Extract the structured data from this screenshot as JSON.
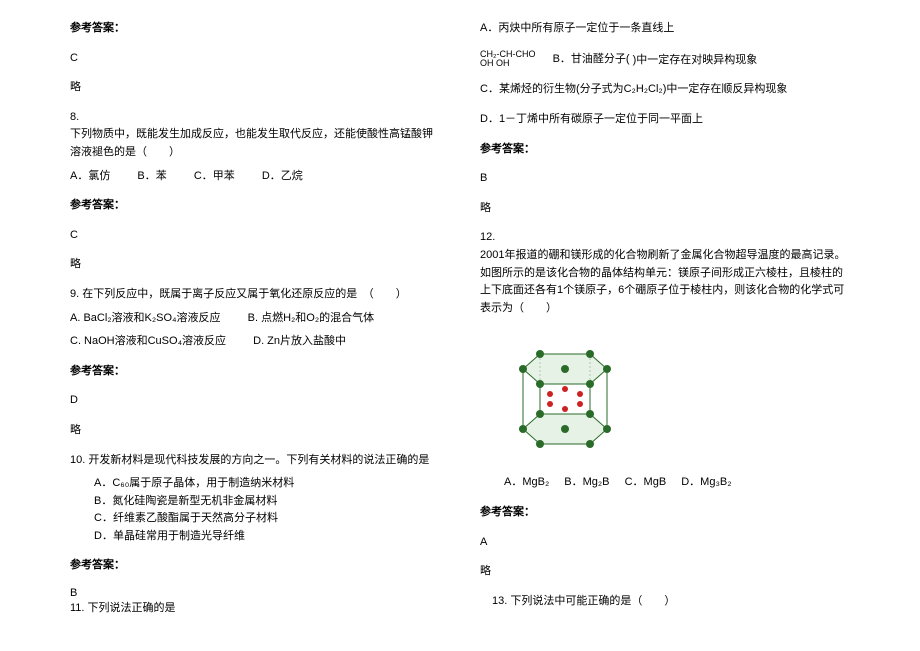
{
  "labels": {
    "answer_heading": "参考答案：",
    "lue": "略"
  },
  "left": {
    "ans7": "C",
    "q8": {
      "num": "8.",
      "stem": "下列物质中，既能发生加成反应，也能发生取代反应，还能使酸性高锰酸钾溶液褪色的是（　　）",
      "a": "A．氯仿",
      "b": "B．苯",
      "c": "C．甲苯",
      "d": "D．乙烷",
      "ans": "C"
    },
    "q9": {
      "stem": "9. 在下列反应中，既属于离子反应又属于氧化还原反应的是　（　　）",
      "a": "A. BaCl₂溶液和K₂SO₄溶液反应",
      "b": "B. 点燃H₂和O₂的混合气体",
      "c": "C. NaOH溶液和CuSO₄溶液反应",
      "d": "D. Zn片放入盐酸中",
      "ans": "D"
    },
    "q10": {
      "stem": "10. 开发新材料是现代科技发展的方向之一。下列有关材料的说法正确的是",
      "a": "A．C₆₀属于原子晶体，用于制造纳米材料",
      "b": "B．氮化硅陶瓷是新型无机非金属材料",
      "c": "C．纤维素乙酸酯属于天然高分子材料",
      "d": "D．单晶硅常用于制造光导纤维",
      "ans": "B"
    },
    "q11": {
      "stem": "11. 下列说法正确的是"
    }
  },
  "right": {
    "q11": {
      "a": "A．丙炔中所有原子一定位于一条直线上",
      "formula1": "CH₂-CH-CHO",
      "formula2": "OH  OH",
      "b_label": "B．甘油醛分子(",
      "b_tail": ")中一定存在对映异构现象",
      "c": "C．某烯烃的衍生物(分子式为C₂H₂Cl₂)中一定存在顺反异构现象",
      "d": "D．1－丁烯中所有碳原子一定位于同一平面上",
      "ans": "B"
    },
    "q12": {
      "num": "12.",
      "stem": "2001年报道的硼和镁形成的化合物刷新了金属化合物超导温度的最高记录。如图所示的是该化合物的晶体结构单元：镁原子间形成正六棱柱，且棱柱的上下底面还各有1个镁原子，6个硼原子位于棱柱内，则该化合物的化学式可表示为（　　）",
      "a": "A．MgB₂",
      "b": "B．Mg₂B",
      "c": "C．MgB",
      "d": "D．Mg₃B₂",
      "ans": "A"
    },
    "q13": {
      "stem": "13. 下列说法中可能正确的是（　　）"
    }
  }
}
